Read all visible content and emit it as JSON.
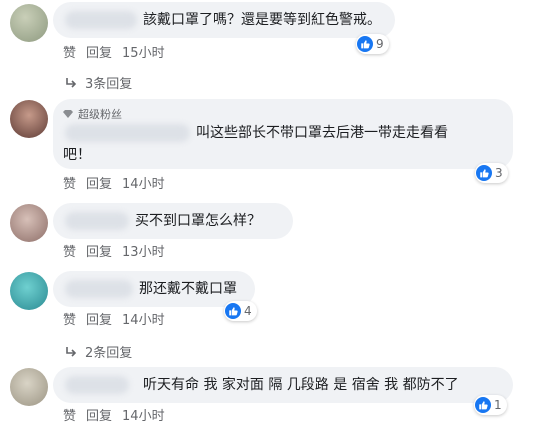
{
  "comments": [
    {
      "text": "該戴口罩了嗎？還是要等到紅色警戒。",
      "likes": "9",
      "like_label": "赞",
      "reply_label": "回复",
      "time": "15小时",
      "replies": "3条回复"
    },
    {
      "badge": "超级粉丝",
      "text_line1": "叫这些部长不带口罩去后港一带走走看看",
      "text_line2": "吧！",
      "likes": "3",
      "like_label": "赞",
      "reply_label": "回复",
      "time": "14小时"
    },
    {
      "text": "买不到口罩怎么样？",
      "like_label": "赞",
      "reply_label": "回复",
      "time": "13小时"
    },
    {
      "text": "那还戴不戴口罩",
      "likes": "4",
      "like_label": "赞",
      "reply_label": "回复",
      "time": "14小时",
      "replies": "2条回复"
    },
    {
      "text": "听天有命 我 家对面 隔 几段路 是 宿舍 我 都防不了",
      "likes": "1",
      "like_label": "赞",
      "reply_label": "回复",
      "time": "14小时"
    }
  ],
  "colors": {
    "accent": "#1877f2",
    "bubble": "#f0f2f5",
    "meta": "#65676b"
  },
  "icons": {
    "like": "thumbs-up-icon",
    "reply_arrow": "reply-arrow-icon",
    "fan": "diamond-icon"
  }
}
